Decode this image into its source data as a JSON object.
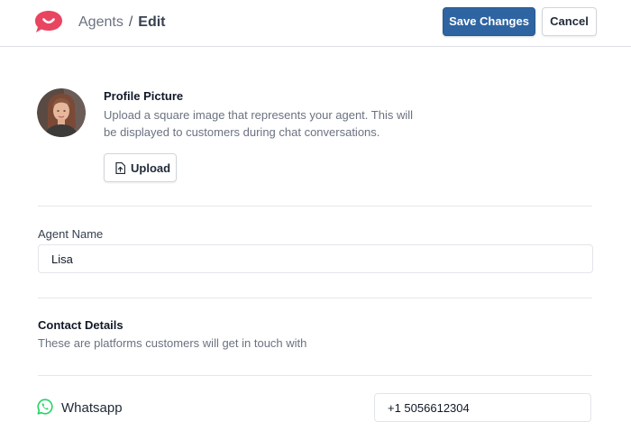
{
  "header": {
    "logo_icon": "chat-bubble-smile-icon",
    "brand_color": "#e94560",
    "breadcrumb": {
      "parent": "Agents",
      "separator": "/",
      "current": "Edit"
    },
    "save_label": "Save Changes",
    "cancel_label": "Cancel",
    "primary_color": "#2e64a1"
  },
  "profile": {
    "title": "Profile Picture",
    "description": "Upload a square image that represents your agent. This will be displayed to customers during chat conversations.",
    "upload_label": "Upload",
    "upload_icon": "file-upload-icon",
    "avatar": "agent-avatar-photo"
  },
  "agent_name": {
    "label": "Agent Name",
    "value": "Lisa"
  },
  "contact": {
    "title": "Contact Details",
    "description": "These are platforms customers will get in touch with",
    "channels": [
      {
        "name": "Whatsapp",
        "icon": "whatsapp-icon",
        "icon_color": "#25d366",
        "value": "+1 5056612304"
      }
    ]
  }
}
